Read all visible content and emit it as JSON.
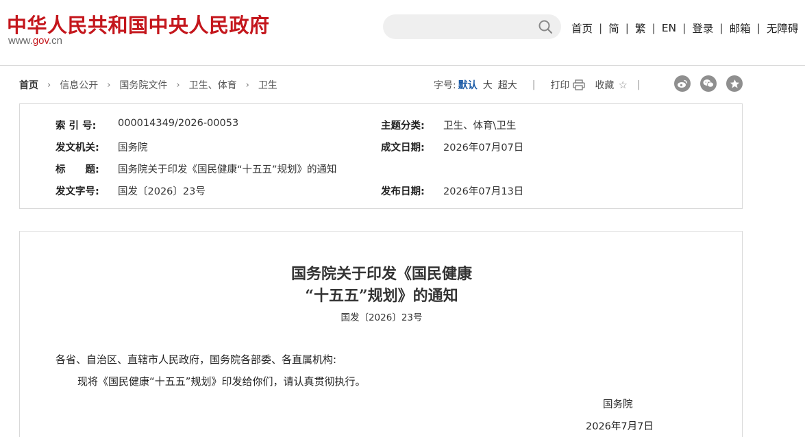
{
  "header": {
    "site_title": "中华人民共和国中央人民政府",
    "site_url_prefix": "www.",
    "site_url_gov": "gov",
    "site_url_suffix": ".cn",
    "search": {
      "placeholder": ""
    },
    "nav": [
      "首页",
      "简",
      "繁",
      "EN",
      "登录",
      "邮箱",
      "无障碍"
    ],
    "nav_separator": "|"
  },
  "breadcrumb": {
    "items": [
      "首页",
      "信息公开",
      "国务院文件",
      "卫生、体育",
      "卫生"
    ],
    "arrow": "›"
  },
  "tools": {
    "font_size_label": "字号:",
    "font_default": "默认",
    "font_large": "大",
    "font_xlarge": "超大",
    "separator": "|",
    "print_label": "打印",
    "favorite_label": "收藏",
    "share_icons": [
      "weibo-icon",
      "wechat-icon",
      "qzone-icon"
    ]
  },
  "meta": {
    "index_label": "索 引 号:",
    "index_value": "000014349/2026-00053",
    "topic_label": "主题分类:",
    "topic_value": "卫生、体育\\卫生",
    "issuer_label": "发文机关:",
    "issuer_value": "国务院",
    "written_label": "成文日期:",
    "written_value": "2026年07月07日",
    "title_label": "标　　题:",
    "title_value": "国务院关于印发《国民健康“十五五”规划》的通知",
    "docno_label": "发文字号:",
    "docno_value": "国发〔2026〕23号",
    "published_label": "发布日期:",
    "published_value": "2026年07月13日"
  },
  "document": {
    "title_line1": "国务院关于印发《国民健康",
    "title_line2": "“十五五”规划》的通知",
    "number": "国发〔2026〕23号",
    "salutation": "各省、自治区、直辖市人民政府，国务院各部委、各直属机构:",
    "body": "现将《国民健康“十五五”规划》印发给你们，请认真贯彻执行。",
    "signature": "国务院",
    "date": "2026年7月7日"
  },
  "colors": {
    "brand_red": "#c4161c",
    "link_blue": "#1a5aa6",
    "border_gray": "#d9d9d9",
    "icon_gray": "#8f8f8f"
  }
}
